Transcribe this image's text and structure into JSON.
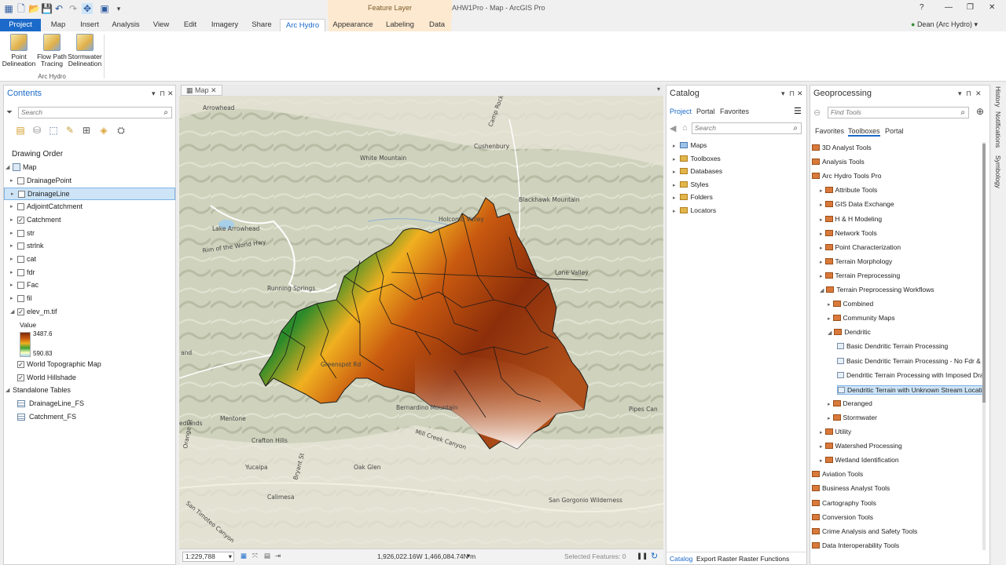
{
  "app": {
    "title": "AHW1Pro - Map - ArcGIS Pro",
    "context_tab_group": "Feature Layer",
    "user": "Dean (Arc Hydro)",
    "help": "?",
    "minimize": "—",
    "restore": "❐",
    "close": "✕"
  },
  "ribbon": {
    "tabs": [
      "Project",
      "Map",
      "Insert",
      "Analysis",
      "View",
      "Edit",
      "Imagery",
      "Share",
      "Arc Hydro",
      "Appearance",
      "Labeling",
      "Data"
    ],
    "active_tab": "Arc Hydro",
    "buttons": [
      {
        "label1": "Point",
        "label2": "Delineation"
      },
      {
        "label1": "Flow Path",
        "label2": "Tracing"
      },
      {
        "label1": "Stormwater",
        "label2": "Delineation"
      }
    ],
    "group_label": "Arc Hydro"
  },
  "contents": {
    "title": "Contents",
    "search_placeholder": "Search",
    "drawing_order": "Drawing Order",
    "map_label": "Map",
    "layers": [
      {
        "name": "DrainagePoint",
        "checked": false
      },
      {
        "name": "DrainageLine",
        "checked": false
      },
      {
        "name": "AdjointCatchment",
        "checked": false
      },
      {
        "name": "Catchment",
        "checked": true
      },
      {
        "name": "str",
        "checked": false
      },
      {
        "name": "strlnk",
        "checked": false
      },
      {
        "name": "cat",
        "checked": false
      },
      {
        "name": "fdr",
        "checked": false
      },
      {
        "name": "Fac",
        "checked": false
      },
      {
        "name": "fil",
        "checked": false
      },
      {
        "name": "elev_m.tif",
        "checked": true
      }
    ],
    "legend_title": "Value",
    "legend_max": "3487.6",
    "legend_min": "590.83",
    "basemaps": [
      {
        "name": "World Topographic Map",
        "checked": true
      },
      {
        "name": "World Hillshade",
        "checked": true
      }
    ],
    "standalone_title": "Standalone Tables",
    "tables": [
      "DrainageLine_FS",
      "Catchment_FS"
    ]
  },
  "map": {
    "tab_label": "Map",
    "places": [
      "Arrowhead",
      "White Mountain",
      "Cushenbury",
      "Blackhawk Mountain",
      "Lake Arrowhead",
      "Holcomb Valley",
      "Running Springs",
      "Lone Valley",
      "and",
      "Mentone",
      "Crafton Hills",
      "edlands",
      "Yucaipa",
      "Oak Glen",
      "Calimesa",
      "Bernardino Mountain",
      "San Gorgonio Wilderness",
      "Pipes Can",
      "Mill Creek Canyon",
      "San Timoteo Canyon",
      "Camp Rock",
      "Rim of the World Hwy",
      "Orange St",
      "Bryant St",
      "Greenspot Rd"
    ],
    "scale": "1:229,788",
    "coords": "1,926,022.16W 1,466,084.74N m",
    "selected_features": "Selected Features: 0",
    "pause": "❚❚",
    "refresh": "↻"
  },
  "catalog": {
    "title": "Catalog",
    "subtabs": [
      "Project",
      "Portal",
      "Favorites"
    ],
    "search_placeholder": "Search",
    "items": [
      "Maps",
      "Toolboxes",
      "Databases",
      "Styles",
      "Folders",
      "Locators"
    ],
    "footer_tabs": [
      "Catalog",
      "Export Raster",
      "Raster Functions"
    ]
  },
  "geoprocessing": {
    "title": "Geoprocessing",
    "search_placeholder": "Find Tools",
    "subtabs": [
      "Favorites",
      "Toolboxes",
      "Portal"
    ],
    "items": [
      {
        "label": "3D Analyst Tools",
        "level": 0,
        "kind": "toolbox"
      },
      {
        "label": "Analysis Tools",
        "level": 0,
        "kind": "toolbox"
      },
      {
        "label": "Arc Hydro Tools Pro",
        "level": 0,
        "kind": "toolbox"
      },
      {
        "label": "Attribute Tools",
        "level": 1,
        "kind": "toolset",
        "tri": "▸"
      },
      {
        "label": "GIS Data Exchange",
        "level": 1,
        "kind": "toolset",
        "tri": "▸"
      },
      {
        "label": "H & H Modeling",
        "level": 1,
        "kind": "toolset",
        "tri": "▸"
      },
      {
        "label": "Network Tools",
        "level": 1,
        "kind": "toolset",
        "tri": "▸"
      },
      {
        "label": "Point Characterization",
        "level": 1,
        "kind": "toolset",
        "tri": "▸"
      },
      {
        "label": "Terrain Morphology",
        "level": 1,
        "kind": "toolset",
        "tri": "▸"
      },
      {
        "label": "Terrain Preprocessing",
        "level": 1,
        "kind": "toolset",
        "tri": "▸"
      },
      {
        "label": "Terrain Preprocessing Workflows",
        "level": 1,
        "kind": "toolset",
        "tri": "◢"
      },
      {
        "label": "Combined",
        "level": 2,
        "kind": "toolset",
        "tri": "▸"
      },
      {
        "label": "Community Maps",
        "level": 2,
        "kind": "toolset",
        "tri": "▸"
      },
      {
        "label": "Dendritic",
        "level": 2,
        "kind": "toolset",
        "tri": "◢"
      },
      {
        "label": "Basic Dendritic Terrain Processing",
        "level": 3,
        "kind": "tool"
      },
      {
        "label": "Basic Dendritic Terrain Processing - No Fdr & Fac",
        "level": 3,
        "kind": "tool"
      },
      {
        "label": "Dendritic Terrain Processing with Imposed Drainage",
        "level": 3,
        "kind": "tool"
      },
      {
        "label": "Dendritic Terrain with Unknown Stream Location",
        "level": 3,
        "kind": "tool",
        "selected": true
      },
      {
        "label": "Deranged",
        "level": 2,
        "kind": "toolset",
        "tri": "▸"
      },
      {
        "label": "Stormwater",
        "level": 2,
        "kind": "toolset",
        "tri": "▸"
      },
      {
        "label": "Utility",
        "level": 1,
        "kind": "toolset",
        "tri": "▸"
      },
      {
        "label": "Watershed Processing",
        "level": 1,
        "kind": "toolset",
        "tri": "▸"
      },
      {
        "label": "Wetland Identification",
        "level": 1,
        "kind": "toolset",
        "tri": "▸"
      },
      {
        "label": "Aviation Tools",
        "level": 0,
        "kind": "toolbox"
      },
      {
        "label": "Business Analyst Tools",
        "level": 0,
        "kind": "toolbox"
      },
      {
        "label": "Cartography Tools",
        "level": 0,
        "kind": "toolbox"
      },
      {
        "label": "Conversion Tools",
        "level": 0,
        "kind": "toolbox"
      },
      {
        "label": "Crime Analysis and Safety Tools",
        "level": 0,
        "kind": "toolbox"
      },
      {
        "label": "Data Interoperability Tools",
        "level": 0,
        "kind": "toolbox"
      }
    ]
  },
  "side_tabs": [
    "History",
    "Notifications",
    "Symbology"
  ],
  "colors": {
    "accent": "#1b6ac9",
    "selection": "#cde4f7"
  }
}
